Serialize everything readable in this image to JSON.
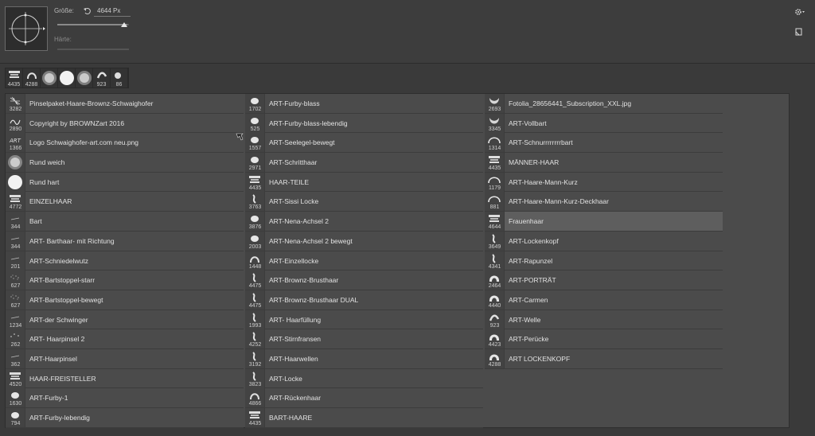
{
  "settings": {
    "size_label": "Größe:",
    "size_value": "4644 Px",
    "hardness_label": "Härte:",
    "size_fraction": 0.98,
    "hardness_fraction": 0.0
  },
  "toolbar": {
    "gear_icon": "gear-icon",
    "new_preset_icon": "new-preset-icon"
  },
  "recent_brushes": [
    {
      "count": "4435",
      "icon": "tuft-icon"
    },
    {
      "count": "4288",
      "icon": "curl-icon"
    },
    {
      "count": "",
      "icon": "soft-round-icon"
    },
    {
      "count": "",
      "icon": "hard-round-icon"
    },
    {
      "count": "",
      "icon": "soft-round-icon"
    },
    {
      "count": "923",
      "icon": "wave-icon"
    },
    {
      "count": "86",
      "icon": "small-round-icon"
    }
  ],
  "columns": [
    [
      {
        "count": "3282",
        "name": "Pinselpaket-Haare-Brownz-Schwaighofer",
        "icon": "texture-icon"
      },
      {
        "count": "2890",
        "name": "Copyright by BROWNZart 2016",
        "icon": "scribble-icon"
      },
      {
        "count": "1366",
        "name": "Logo Schwaighofer-art.com neu.png",
        "icon": "logo-icon"
      },
      {
        "count": "",
        "name": "Rund weich",
        "icon": "soft-round-icon"
      },
      {
        "count": "",
        "name": "Rund hart",
        "icon": "hard-round-icon"
      },
      {
        "count": "4772",
        "name": "EINZELHAAR",
        "icon": "tuft-icon"
      },
      {
        "count": "344",
        "name": "Bart",
        "icon": "line-icon"
      },
      {
        "count": "344",
        "name": "ART- Barthaar- mit Richtung",
        "icon": "line-icon"
      },
      {
        "count": "201",
        "name": "ART-Schniedelwutz",
        "icon": "line-icon"
      },
      {
        "count": "627",
        "name": "ART-Bartstoppel-starr",
        "icon": "speckle-icon"
      },
      {
        "count": "627",
        "name": "ART-Bartstoppel-bewegt",
        "icon": "speckle-icon"
      },
      {
        "count": "1234",
        "name": "ART-der Schwinger",
        "icon": "line-icon"
      },
      {
        "count": "262",
        "name": "ART- Haarpinsel 2",
        "icon": "dots-icon"
      },
      {
        "count": "362",
        "name": "ART-Haarpinsel",
        "icon": "line-icon"
      },
      {
        "count": "4520",
        "name": "HAAR-FREISTELLER",
        "icon": "tuft-icon"
      },
      {
        "count": "1630",
        "name": "ART-Furby-1",
        "icon": "blob-icon"
      },
      {
        "count": "794",
        "name": "ART-Furby-lebendig",
        "icon": "blob-icon"
      }
    ],
    [
      {
        "count": "1702",
        "name": "ART-Furby-blass",
        "icon": "blob-icon"
      },
      {
        "count": "525",
        "name": "ART-Furby-blass-lebendig",
        "icon": "blob-icon"
      },
      {
        "count": "1557",
        "name": "ART-Seelegel-bewegt",
        "icon": "blob-icon"
      },
      {
        "count": "2971",
        "name": "ART-Schritthaar",
        "icon": "blob-icon"
      },
      {
        "count": "4435",
        "name": "HAAR-TEILE",
        "icon": "tuft-icon"
      },
      {
        "count": "3763",
        "name": "ART-Sissi Locke",
        "icon": "strand-icon"
      },
      {
        "count": "3876",
        "name": "ART-Nena-Achsel 2",
        "icon": "blob-icon"
      },
      {
        "count": "2003",
        "name": "ART-Nena-Achsel 2 bewegt",
        "icon": "blob-icon"
      },
      {
        "count": "1448",
        "name": "ART-Einzellocke",
        "icon": "curl-icon"
      },
      {
        "count": "4475",
        "name": "ART-Brownz-Brusthaar",
        "icon": "strand-icon"
      },
      {
        "count": "4475",
        "name": "ART-Brownz-Brusthaar DUAL",
        "icon": "strand-icon"
      },
      {
        "count": "1993",
        "name": "ART- Haarfüllung",
        "icon": "strand-icon"
      },
      {
        "count": "4252",
        "name": "ART-Stirnfransen",
        "icon": "strand-icon"
      },
      {
        "count": "3192",
        "name": "ART-Haarwellen",
        "icon": "strand-icon"
      },
      {
        "count": "3823",
        "name": "ART-Locke",
        "icon": "strand-icon"
      },
      {
        "count": "4866",
        "name": "ART-Rückenhaar",
        "icon": "curl-icon"
      },
      {
        "count": "4435",
        "name": "BART-HAARE",
        "icon": "tuft-icon"
      }
    ],
    [
      {
        "count": "2693",
        "name": "Fotolia_28656441_Subscription_XXL.jpg",
        "icon": "beard-icon"
      },
      {
        "count": "3345",
        "name": "ART-Vollbart",
        "icon": "beard-icon"
      },
      {
        "count": "1314",
        "name": "ART-Schnurrrrrrrrbart",
        "icon": "arc-icon"
      },
      {
        "count": "4435",
        "name": "MÄNNER-HAAR",
        "icon": "tuft-icon"
      },
      {
        "count": "1179",
        "name": "ART-Haare-Mann-Kurz",
        "icon": "arc-icon"
      },
      {
        "count": "881",
        "name": "ART-Haare-Mann-Kurz-Deckhaar",
        "icon": "arc-icon"
      },
      {
        "count": "4644",
        "name": "Frauenhaar",
        "icon": "tuft-icon",
        "selected": true
      },
      {
        "count": "3649",
        "name": "ART-Lockenkopf",
        "icon": "strand-icon"
      },
      {
        "count": "4341",
        "name": "ART-Rapunzel",
        "icon": "strand-icon"
      },
      {
        "count": "2464",
        "name": "ART-PORTRÄT",
        "icon": "wig-icon"
      },
      {
        "count": "4440",
        "name": "ART-Carmen",
        "icon": "wig-icon"
      },
      {
        "count": "923",
        "name": "ART-Welle",
        "icon": "wave-icon"
      },
      {
        "count": "4423",
        "name": "ART-Perücke",
        "icon": "wig-icon"
      },
      {
        "count": "4288",
        "name": "ART LOCKENKOPF",
        "icon": "wig-icon"
      }
    ]
  ]
}
